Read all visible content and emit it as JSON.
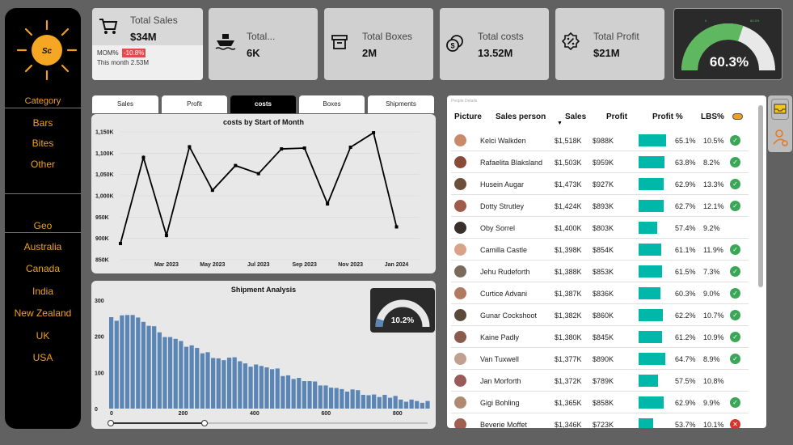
{
  "brand": {
    "logo_text": "Sc"
  },
  "sidebar": {
    "category_title": "Category",
    "categories": [
      "Bars",
      "Bites",
      "Other"
    ],
    "geo_title": "Geo",
    "geos": [
      "Australia",
      "Canada",
      "India",
      "New Zealand",
      "UK",
      "USA"
    ]
  },
  "kpis": {
    "total_sales": {
      "label": "Total Sales",
      "value": "$34M",
      "mom_label": "MOM%",
      "mom_value": "-10.8%",
      "month_text": "This month 2.53M"
    },
    "total_shipments": {
      "label": "Total...",
      "value": "6K"
    },
    "total_boxes": {
      "label": "Total Boxes",
      "value": "2M"
    },
    "total_costs": {
      "label": "Total costs",
      "value": "13.52M"
    },
    "total_profit": {
      "label": "Total Profit",
      "value": "$21M"
    },
    "profit_gauge": {
      "value_text": "60.3%",
      "mini_left": "0",
      "mini_right": "60.3%",
      "fraction": 0.603
    }
  },
  "tabs": [
    "Sales",
    "Profit",
    "costs",
    "Boxes",
    "Shipments"
  ],
  "active_tab": "costs",
  "chart_data": [
    {
      "type": "line",
      "title": "costs by Start of Month",
      "x": [
        "Jan 2023",
        "Feb 2023",
        "Mar 2023",
        "Apr 2023",
        "May 2023",
        "Jun 2023",
        "Jul 2023",
        "Aug 2023",
        "Sep 2023",
        "Oct 2023",
        "Nov 2023",
        "Dec 2023",
        "Jan 2024",
        "Feb 2024"
      ],
      "x_tick_labels": [
        "Mar 2023",
        "May 2023",
        "Jul 2023",
        "Sep 2023",
        "Nov 2023",
        "Jan 2024"
      ],
      "values": [
        888,
        1090,
        907,
        1115,
        1013,
        1071,
        1052,
        1110,
        1112,
        981,
        1114,
        1148,
        927
      ],
      "y_tick_labels": [
        "1,150K",
        "1,100K",
        "1,050K",
        "1,000K",
        "950K",
        "900K",
        "850K"
      ],
      "ylim": [
        850,
        1150
      ]
    },
    {
      "type": "bar",
      "title": "Shipment Analysis",
      "x_tick_labels": [
        "0",
        "200",
        "400",
        "600",
        "800"
      ],
      "y_tick_labels": [
        "300",
        "200",
        "100",
        "0"
      ],
      "xlim": [
        0,
        900
      ],
      "ylim": [
        0,
        300
      ],
      "values": [
        253,
        243,
        258,
        259,
        259,
        252,
        240,
        229,
        228,
        211,
        198,
        198,
        193,
        187,
        171,
        175,
        168,
        153,
        156,
        140,
        139,
        134,
        141,
        142,
        131,
        125,
        116,
        122,
        118,
        114,
        109,
        111,
        90,
        92,
        82,
        85,
        76,
        76,
        75,
        64,
        64,
        58,
        57,
        54,
        47,
        53,
        51,
        38,
        37,
        39,
        32,
        38,
        30,
        35,
        25,
        19,
        25,
        21,
        16,
        21
      ]
    },
    {
      "type": "gauge",
      "value_text": "10.2%",
      "fraction": 0.102
    }
  ],
  "people": {
    "caption": "People Details",
    "columns": [
      "Picture",
      "Sales person",
      "Sales",
      "Profit",
      "Profit %",
      "LBS%"
    ],
    "rows": [
      {
        "name": "Kelci Walkden",
        "sales": "$1,518K",
        "profit": "$988K",
        "pct": "65.1%",
        "pct_num": 65.1,
        "lbs": "10.5%",
        "status": "ok"
      },
      {
        "name": "Rafaelita Blaksland",
        "sales": "$1,503K",
        "profit": "$959K",
        "pct": "63.8%",
        "pct_num": 63.8,
        "lbs": "8.2%",
        "status": "ok"
      },
      {
        "name": "Husein Augar",
        "sales": "$1,473K",
        "profit": "$927K",
        "pct": "62.9%",
        "pct_num": 62.9,
        "lbs": "13.3%",
        "status": "ok"
      },
      {
        "name": "Dotty Strutley",
        "sales": "$1,424K",
        "profit": "$893K",
        "pct": "62.7%",
        "pct_num": 62.7,
        "lbs": "12.1%",
        "status": "ok"
      },
      {
        "name": "Oby Sorrel",
        "sales": "$1,400K",
        "profit": "$803K",
        "pct": "57.4%",
        "pct_num": 57.4,
        "lbs": "9.2%",
        "status": "none"
      },
      {
        "name": "Camilla Castle",
        "sales": "$1,398K",
        "profit": "$854K",
        "pct": "61.1%",
        "pct_num": 61.1,
        "lbs": "11.9%",
        "status": "ok"
      },
      {
        "name": "Jehu Rudeforth",
        "sales": "$1,388K",
        "profit": "$853K",
        "pct": "61.5%",
        "pct_num": 61.5,
        "lbs": "7.3%",
        "status": "ok"
      },
      {
        "name": "Curtice Advani",
        "sales": "$1,387K",
        "profit": "$836K",
        "pct": "60.3%",
        "pct_num": 60.3,
        "lbs": "9.0%",
        "status": "ok"
      },
      {
        "name": "Gunar Cockshoot",
        "sales": "$1,382K",
        "profit": "$860K",
        "pct": "62.2%",
        "pct_num": 62.2,
        "lbs": "10.7%",
        "status": "ok"
      },
      {
        "name": "Kaine Padly",
        "sales": "$1,380K",
        "profit": "$845K",
        "pct": "61.2%",
        "pct_num": 61.2,
        "lbs": "10.9%",
        "status": "ok"
      },
      {
        "name": "Van Tuxwell",
        "sales": "$1,377K",
        "profit": "$890K",
        "pct": "64.7%",
        "pct_num": 64.7,
        "lbs": "8.9%",
        "status": "ok"
      },
      {
        "name": "Jan Morforth",
        "sales": "$1,372K",
        "profit": "$789K",
        "pct": "57.5%",
        "pct_num": 57.5,
        "lbs": "10.8%",
        "status": "none"
      },
      {
        "name": "Gigi Bohling",
        "sales": "$1,365K",
        "profit": "$858K",
        "pct": "62.9%",
        "pct_num": 62.9,
        "lbs": "9.9%",
        "status": "ok"
      },
      {
        "name": "Beverie Moffet",
        "sales": "$1,346K",
        "profit": "$723K",
        "pct": "53.7%",
        "pct_num": 53.7,
        "lbs": "10.1%",
        "status": "bad"
      }
    ]
  },
  "colors": {
    "accent": "#f0a020",
    "teal": "#00b8a9",
    "bar_blue": "#5b85b5",
    "gauge_green": "#5fb760",
    "ok": "#3aa757",
    "bad": "#d9342b"
  }
}
